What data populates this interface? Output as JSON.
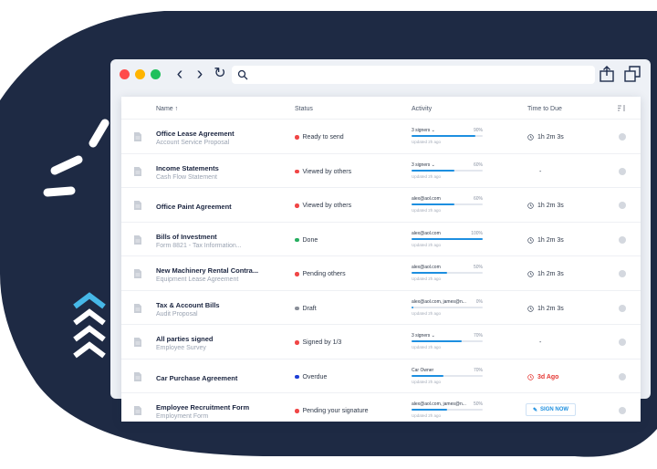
{
  "colors": {
    "background_dark": "#1e2a44",
    "accent": "#1d8fe0",
    "chevron_cyan": "#46b8e8"
  },
  "browser": {
    "traffic_lights": [
      "#ff4b4b",
      "#ffb400",
      "#20c05c"
    ],
    "address_placeholder": ""
  },
  "table": {
    "columns": {
      "name": "Name",
      "status": "Status",
      "activity": "Activity",
      "time_to_due": "Time to Due"
    },
    "sort_indicator": "↑",
    "rows": [
      {
        "name": "Office Lease Agreement",
        "sub": "Account Service Proposal",
        "status": "Ready to send",
        "status_color": "#f04646",
        "activity_label": "3 signers ⌄",
        "activity_pct": "90%",
        "activity_value": 0.9,
        "updated": "Updated 2h ago",
        "due": "1h 2m 3s"
      },
      {
        "name": "Income Statements",
        "sub": "Cash Flow Statement",
        "status": "Viewed by others",
        "status_color": "#f04646",
        "activity_label": "3 signers ⌄",
        "activity_pct": "60%",
        "activity_value": 0.6,
        "updated": "Updated 2h ago",
        "due": "-"
      },
      {
        "name": "Office Paint Agreement",
        "sub": "",
        "status": "Viewed by others",
        "status_color": "#f04646",
        "activity_label": "alex@aol.com",
        "activity_pct": "60%",
        "activity_value": 0.6,
        "updated": "Updated 2h ago",
        "due": "1h 2m 3s"
      },
      {
        "name": "Bills of Investment",
        "sub": "Form 8821 - Tax Information...",
        "status": "Done",
        "status_color": "#27ae60",
        "activity_label": "alex@aol.com",
        "activity_pct": "100%",
        "activity_value": 1.0,
        "updated": "Updated 2h ago",
        "due": "1h 2m 3s"
      },
      {
        "name": "New Machinery Rental Contra...",
        "sub": "Equipment Lease Agreement",
        "status": "Pending others",
        "status_color": "#f04646",
        "activity_label": "alex@aol.com",
        "activity_pct": "50%",
        "activity_value": 0.5,
        "updated": "Updated 2h ago",
        "due": "1h 2m 3s"
      },
      {
        "name": "Tax & Account Bills",
        "sub": "Audit Proposal",
        "status": "Draft",
        "status_color": "#8a8f99",
        "activity_label": "alex@aol.com, james@n...",
        "activity_pct": "0%",
        "activity_value": 0.03,
        "updated": "Updated 2h ago",
        "due": "1h 2m 3s"
      },
      {
        "name": "All parties signed",
        "sub": "Employee Survey",
        "status": "Signed by 1/3",
        "status_color": "#f04646",
        "activity_label": "3 signers ⌄",
        "activity_pct": "70%",
        "activity_value": 0.7,
        "updated": "Updated 2h ago",
        "due": "-"
      },
      {
        "name": "Car Purchase Agreement",
        "sub": "",
        "status": "Overdue",
        "status_color": "#1e3fd6",
        "activity_label": "Car Owner",
        "activity_pct": "70%",
        "activity_value": 0.45,
        "updated": "Updated 2h ago",
        "due": "3d Ago"
      },
      {
        "name": "Employee Recruitment Form",
        "sub": "Employment Form",
        "status": "Pending your signature",
        "status_color": "#f04646",
        "activity_label": "alex@aol.com, james@n...",
        "activity_pct": "50%",
        "activity_value": 0.5,
        "updated": "Updated 2h ago",
        "due": "SIGN NOW"
      }
    ]
  }
}
